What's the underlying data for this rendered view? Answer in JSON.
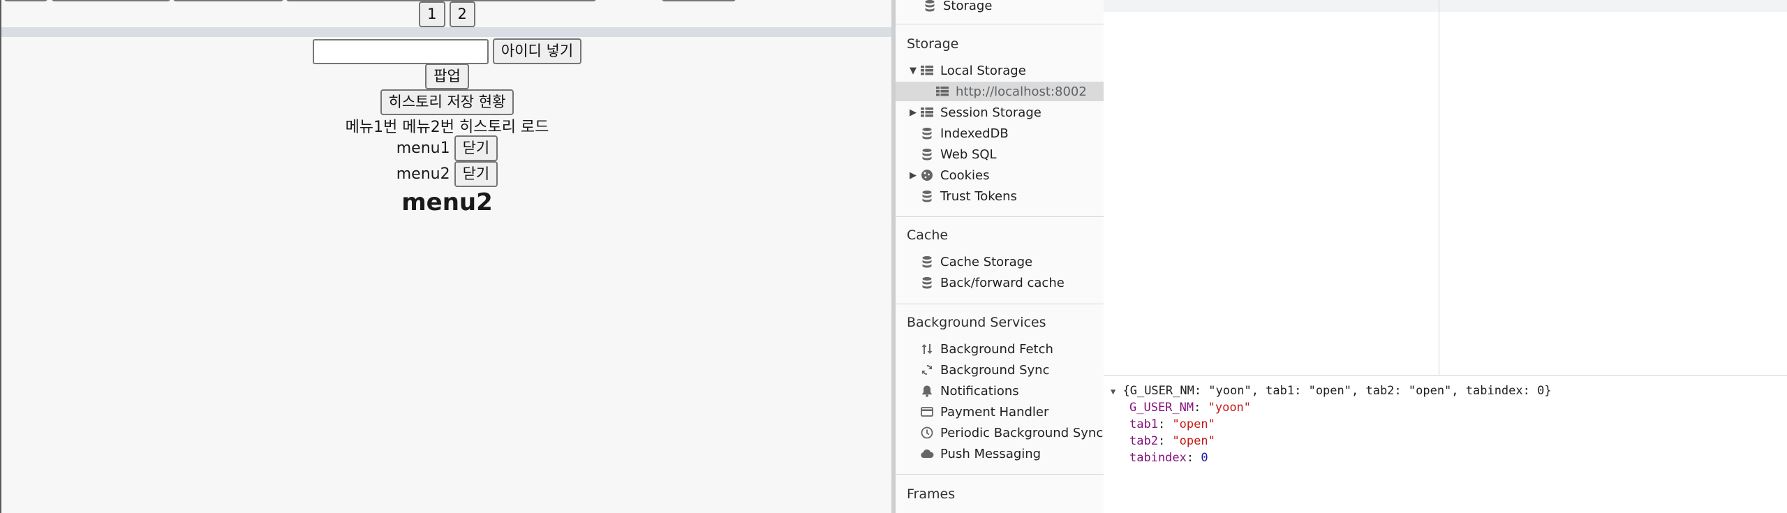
{
  "page": {
    "pagination": [
      "1",
      "2"
    ],
    "id_input": {
      "value": "",
      "placeholder": ""
    },
    "add_id_label": "아이디 넣기",
    "popup_label": "팝업",
    "history_status_label": "히스토리 저장 현황",
    "history_text": "메뉴1번 메뉴2번 히스토리 로드",
    "menus": [
      {
        "label": "menu1",
        "close": "닫기"
      },
      {
        "label": "menu2",
        "close": "닫기"
      }
    ],
    "heading": "menu2"
  },
  "sidebar": {
    "top_item": "Storage",
    "storage_title": "Storage",
    "storage_items": [
      {
        "label": "Local Storage",
        "icon": "grid-icon",
        "expanded": true
      },
      {
        "label": "http://localhost:8002",
        "icon": "grid-icon",
        "selected": true
      },
      {
        "label": "Session Storage",
        "icon": "grid-icon",
        "expanded": false
      },
      {
        "label": "IndexedDB",
        "icon": "database-icon"
      },
      {
        "label": "Web SQL",
        "icon": "database-icon"
      },
      {
        "label": "Cookies",
        "icon": "cookie-icon",
        "expanded": false
      },
      {
        "label": "Trust Tokens",
        "icon": "database-icon"
      }
    ],
    "cache_title": "Cache",
    "cache_items": [
      {
        "label": "Cache Storage",
        "icon": "database-icon"
      },
      {
        "label": "Back/forward cache",
        "icon": "database-icon"
      }
    ],
    "bg_title": "Background Services",
    "bg_items": [
      {
        "label": "Background Fetch",
        "icon": "arrows-updown-icon"
      },
      {
        "label": "Background Sync",
        "icon": "sync-icon"
      },
      {
        "label": "Notifications",
        "icon": "bell-icon"
      },
      {
        "label": "Payment Handler",
        "icon": "card-icon"
      },
      {
        "label": "Periodic Background Sync",
        "icon": "clock-icon"
      },
      {
        "label": "Push Messaging",
        "icon": "cloud-icon"
      }
    ],
    "frames_title": "Frames"
  },
  "preview": {
    "summary": "{G_USER_NM: \"yoon\", tab1: \"open\", tab2: \"open\", tabindex: 0}",
    "props": [
      {
        "key": "G_USER_NM",
        "value": "\"yoon\"",
        "kind": "string"
      },
      {
        "key": "tab1",
        "value": "\"open\"",
        "kind": "string"
      },
      {
        "key": "tab2",
        "value": "\"open\"",
        "kind": "string"
      },
      {
        "key": "tabindex",
        "value": "0",
        "kind": "number"
      }
    ]
  },
  "colors": {
    "separator": "#dadde4",
    "selected_row": "#dadada",
    "key": "#881280",
    "string": "#c41a16",
    "number": "#1a1aa6"
  }
}
